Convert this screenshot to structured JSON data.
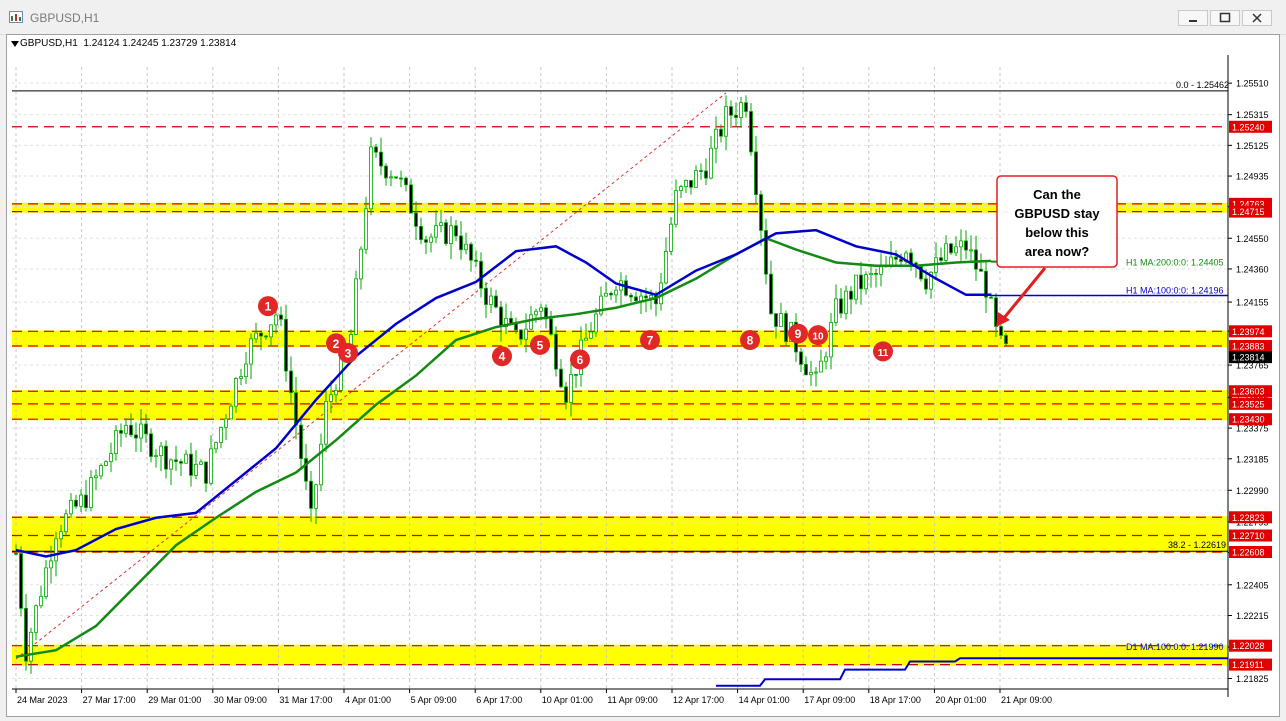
{
  "window": {
    "title": "GBPUSD,H1"
  },
  "header": {
    "symbol": "GBPUSD,H1",
    "ohlc": "1.24124 1.24245 1.23729 1.23814"
  },
  "colors": {
    "zone": "#ffff00",
    "dashed_line": "#d00000",
    "price_label_bg": "#e00000",
    "ma100": "#0000cc",
    "ma200": "#138a13",
    "marker": "#e02828",
    "candle_up": "#00aa00",
    "grid": "#c8c8c8"
  },
  "chart_data": {
    "type": "candlestick",
    "symbol": "GBPUSD",
    "timeframe": "H1",
    "x_ticks": [
      "24 Mar 2023",
      "27 Mar 17:00",
      "29 Mar 01:00",
      "30 Mar 09:00",
      "31 Mar 17:00",
      "4 Apr 01:00",
      "5 Apr 09:00",
      "6 Apr 17:00",
      "10 Apr 01:00",
      "11 Apr 09:00",
      "12 Apr 17:00",
      "14 Apr 01:00",
      "17 Apr 09:00",
      "18 Apr 17:00",
      "20 Apr 01:00",
      "21 Apr 09:00"
    ],
    "y_ticks": [
      "1.25510",
      "1.25315",
      "1.25125",
      "1.24935",
      "1.24745",
      "1.24550",
      "1.24360",
      "1.24155",
      "1.23975",
      "1.23765",
      "1.23565",
      "1.23375",
      "1.23185",
      "1.22990",
      "1.22795",
      "1.22605",
      "1.22405",
      "1.22215",
      "1.22020",
      "1.21825"
    ],
    "ylim": [
      1.2176,
      1.2561
    ],
    "price_lines": [
      {
        "label": "1.25240",
        "price": 1.2524
      },
      {
        "label": "1.24763",
        "price": 1.24763
      },
      {
        "label": "1.24715",
        "price": 1.24715
      },
      {
        "label": "1.23974",
        "price": 1.23974
      },
      {
        "label": "1.23883",
        "price": 1.23883
      },
      {
        "label": "1.23603",
        "price": 1.23603
      },
      {
        "label": "1.23525",
        "price": 1.23525
      },
      {
        "label": "1.23430",
        "price": 1.2343
      },
      {
        "label": "1.22823",
        "price": 1.22823
      },
      {
        "label": "1.22710",
        "price": 1.2271
      },
      {
        "label": "1.22608",
        "price": 1.22608
      },
      {
        "label": "1.22028",
        "price": 1.22028
      },
      {
        "label": "1.21911",
        "price": 1.21911
      }
    ],
    "zones": [
      {
        "low": 1.24715,
        "high": 1.24763
      },
      {
        "low": 1.23883,
        "high": 1.23974
      },
      {
        "low": 1.2343,
        "high": 1.23603
      },
      {
        "low": 1.22608,
        "high": 1.22823
      },
      {
        "low": 1.21911,
        "high": 1.22028
      }
    ],
    "current_price": {
      "label": "1.23814",
      "price": 1.23814
    },
    "fib_labels": [
      {
        "text": "0.0 - 1.25462",
        "price": 1.25462
      },
      {
        "text": "38.2 - 1.22619",
        "price": 1.22619
      }
    ],
    "ma_labels": [
      {
        "text": "H1 MA:200:0:0: 1.24405",
        "price": 1.24405
      },
      {
        "text": "H1 MA:100:0:0: 1.24196",
        "price": 1.24196
      },
      {
        "text": "D1 MA:100:0:0: 1.21990",
        "price": 1.2199
      }
    ],
    "markers": [
      {
        "n": "1",
        "price": 1.2413
      },
      {
        "n": "2",
        "price": 1.239
      },
      {
        "n": "3",
        "price": 1.2384
      },
      {
        "n": "4",
        "price": 1.2382
      },
      {
        "n": "5",
        "price": 1.2389
      },
      {
        "n": "6",
        "price": 1.238
      },
      {
        "n": "7",
        "price": 1.2392
      },
      {
        "n": "8",
        "price": 1.2392
      },
      {
        "n": "9",
        "price": 1.2396
      },
      {
        "n": "10",
        "price": 1.2395
      },
      {
        "n": "11",
        "price": 1.2385
      }
    ],
    "callout": {
      "text": "Can the GBPUSD stay below this area now?",
      "lines": [
        "Can the",
        "GBPUSD stay",
        "below this",
        "area now?"
      ]
    }
  }
}
